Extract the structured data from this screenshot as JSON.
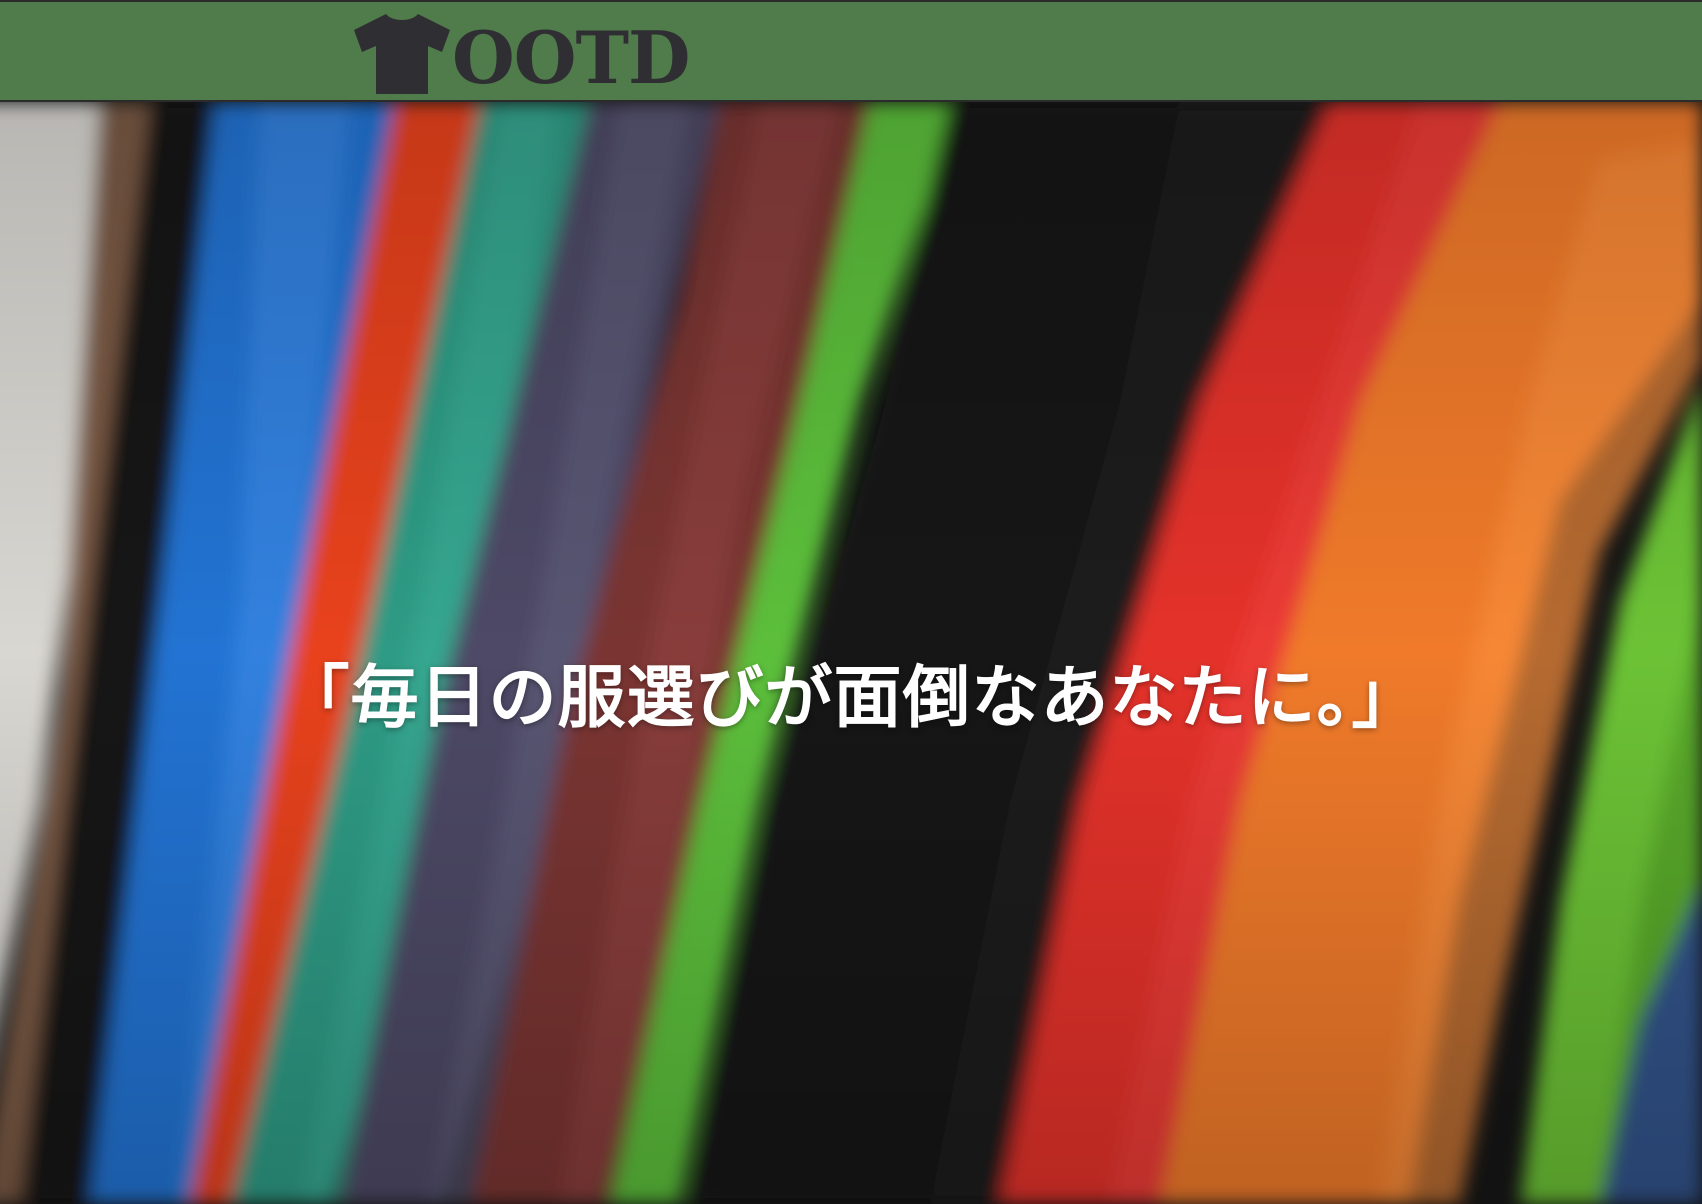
{
  "header": {
    "logo_text": "OOTD",
    "logo_icon": "t-shirt-icon",
    "background_color": "#507b4a"
  },
  "hero": {
    "background_image": "colorful-t-shirts-on-rack-photo",
    "tagline": "「毎日の服選びが面倒なあなたに。」"
  }
}
